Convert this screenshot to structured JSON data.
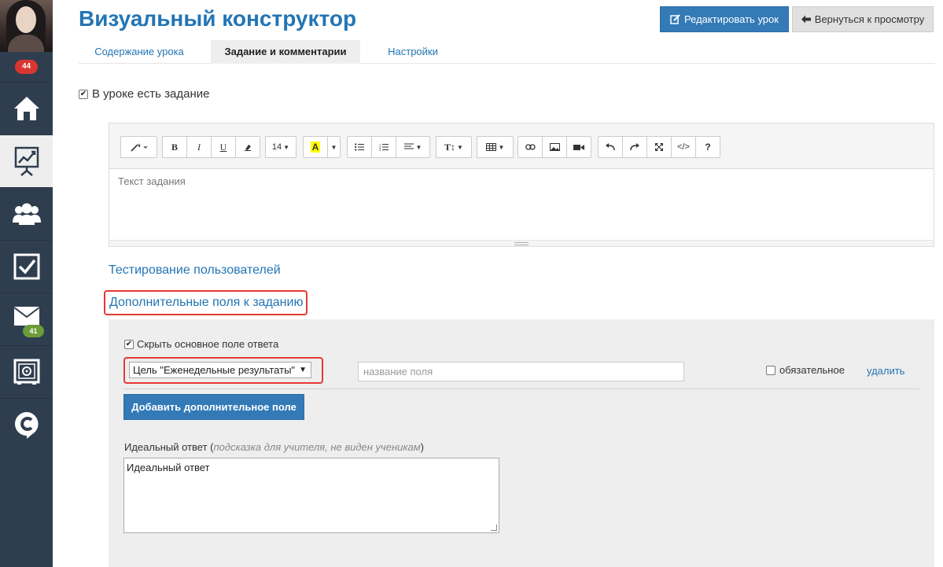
{
  "sidebar": {
    "notifications_badge": "44",
    "items": [
      {
        "name": "home",
        "icon": "home-icon"
      },
      {
        "name": "presentation",
        "icon": "presentation-chart-icon"
      },
      {
        "name": "users",
        "icon": "users-group-icon"
      },
      {
        "name": "tasks",
        "icon": "checkbox-icon"
      },
      {
        "name": "messages",
        "icon": "envelope-icon",
        "badge": "41"
      },
      {
        "name": "safe",
        "icon": "safe-icon"
      },
      {
        "name": "logo",
        "icon": "c-logo-icon"
      }
    ]
  },
  "header": {
    "title": "Визуальный конструктор",
    "edit_button": "Редактировать урок",
    "back_button": "Вернуться к просмотру"
  },
  "tabs": [
    {
      "label": "Содержание урока",
      "active": false
    },
    {
      "label": "Задание и комментарии",
      "active": true
    },
    {
      "label": "Настройки",
      "active": false
    }
  ],
  "task": {
    "has_task_label": "В уроке есть задание",
    "has_task_checked": true
  },
  "editor": {
    "font_size": "14",
    "placeholder": "Текст задания",
    "toolbar": [
      "magic-wand-icon",
      "bold-icon",
      "italic-icon",
      "underline-icon",
      "eraser-icon",
      "font-size-dropdown",
      "highlight-color-icon",
      "unordered-list-icon",
      "ordered-list-icon",
      "align-icon",
      "line-height-icon",
      "table-icon",
      "link-icon",
      "image-icon",
      "video-icon",
      "undo-icon",
      "redo-icon",
      "fullscreen-icon",
      "code-view-icon",
      "help-icon"
    ]
  },
  "links": {
    "testing": "Тестирование пользователей",
    "extra_fields": "Дополнительные поля к заданию"
  },
  "extra": {
    "hide_main_label": "Скрыть основное поле ответа",
    "hide_main_checked": true,
    "select_value": "Цель \"Еженедельные результаты\"",
    "field_name_placeholder": "название поля",
    "required_label": "обязательное",
    "required_checked": false,
    "delete_label": "удалить",
    "add_button": "Добавить дополнительное поле",
    "ideal_label": "Идеальный ответ",
    "ideal_hint_open": " (",
    "ideal_hint": "подсказка для учителя, не виден ученикам",
    "ideal_hint_close": ")",
    "ideal_value": "Идеальный ответ"
  },
  "colors": {
    "sidebar": "#2f3e4f",
    "accent": "#337ab7",
    "link": "#2275b5",
    "highlight_box": "#e53935",
    "badge_red": "#d9362f",
    "badge_green": "#6b9b3a"
  }
}
